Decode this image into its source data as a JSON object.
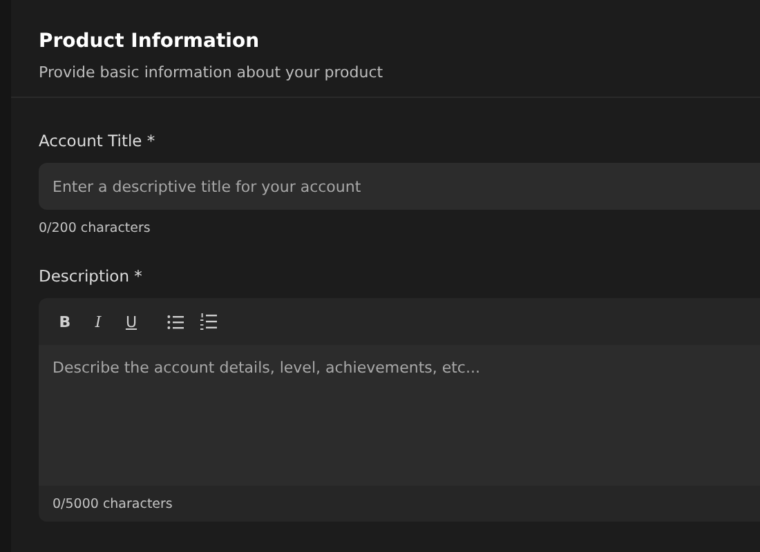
{
  "header": {
    "title": "Product Information",
    "subtitle": "Provide basic information about your product"
  },
  "title_field": {
    "label": "Account Title *",
    "placeholder": "Enter a descriptive title for your account",
    "counter": "0/200 characters"
  },
  "description_field": {
    "label": "Description *",
    "toolbar": [
      {
        "kind": "bold",
        "label": "B"
      },
      {
        "kind": "italic",
        "label": "I"
      },
      {
        "kind": "underline",
        "label": "U"
      },
      {
        "kind": "bullet-list"
      },
      {
        "kind": "numbered-list"
      }
    ],
    "placeholder": "Describe the account details, level, achievements, etc...",
    "counter": "0/5000 characters"
  }
}
